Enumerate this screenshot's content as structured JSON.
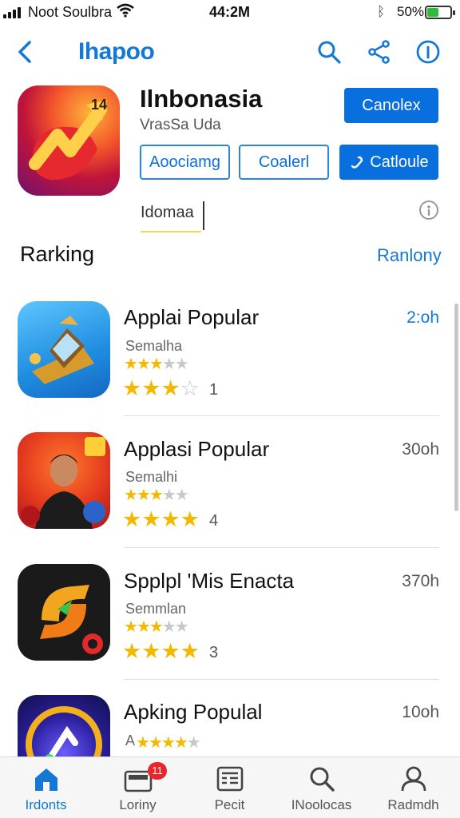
{
  "status_bar": {
    "carrier": "Noot Soulbra",
    "time": "44:2M",
    "battery_pct": "50%",
    "battery_level": 0.5
  },
  "nav": {
    "title": "Ihapoo",
    "icons": [
      "back-chevron-icon",
      "search-icon",
      "share-icon",
      "info-icon"
    ]
  },
  "app": {
    "name": "Ilnbonasia",
    "subtitle": "VrasSa Uda",
    "primary_button": "Canolex",
    "buttons": [
      "Aoociamg",
      "Coalerl",
      "Catloule"
    ],
    "field_value": "Idomaa"
  },
  "section": {
    "title": "Rarking",
    "link": "Ranlony"
  },
  "list": [
    {
      "name": "Applai Popular",
      "time": "2:oh",
      "time_highlight": true,
      "sub": "Semalha",
      "small_rating": 3,
      "large_rating": 3,
      "count": "1"
    },
    {
      "name": "Applasi Popular",
      "time": "30oh",
      "time_highlight": false,
      "sub": "Semalhi",
      "small_rating": 3,
      "large_rating": 4,
      "count": "4"
    },
    {
      "name": "Spplpl 'Mis Enacta",
      "time": "370h",
      "time_highlight": false,
      "sub": "Semmlan",
      "small_rating": 3,
      "large_rating": 4,
      "count": "3"
    },
    {
      "name": "Apking Populal",
      "time": "10oh",
      "time_highlight": false,
      "sub": "A",
      "small_rating": 4,
      "large_rating": 0,
      "count": ""
    }
  ],
  "tabbar": {
    "tabs": [
      {
        "label": "Irdonts",
        "icon": "home-icon",
        "active": true
      },
      {
        "label": "Loriny",
        "icon": "store-icon",
        "active": false,
        "badge": "11"
      },
      {
        "label": "Pecit",
        "icon": "news-icon",
        "active": false
      },
      {
        "label": "INoolocas",
        "icon": "search-icon",
        "active": false
      },
      {
        "label": "Radmdh",
        "icon": "profile-icon",
        "active": false
      }
    ]
  },
  "colors": {
    "accent": "#1478d4",
    "button": "#0a6fde",
    "star": "#f5b800",
    "badge": "#e8262c",
    "battery": "#2ebd3b"
  }
}
